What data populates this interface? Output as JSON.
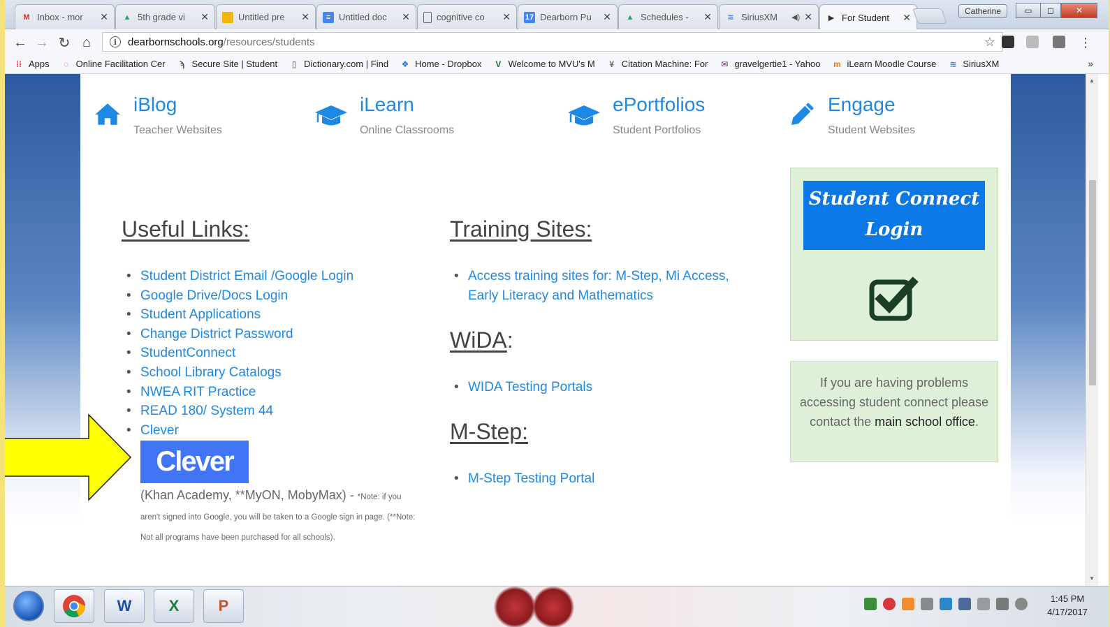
{
  "browser": {
    "tabs": [
      {
        "title": "Inbox - mor",
        "icon": "gmail-icon",
        "icon_glyph": "M",
        "icon_color": "#d93025"
      },
      {
        "title": "5th grade vi",
        "icon": "google-drive-icon",
        "icon_glyph": "▲",
        "icon_color": "#1fa463"
      },
      {
        "title": "Untitled pre",
        "icon": "google-slides-icon",
        "icon_glyph": "▭",
        "icon_color": "#f4b400"
      },
      {
        "title": "Untitled doc",
        "icon": "google-docs-icon",
        "icon_glyph": "≡",
        "icon_color": "#4285f4"
      },
      {
        "title": "cognitive co",
        "icon": "document-icon",
        "icon_glyph": "▯",
        "icon_color": "#666666"
      },
      {
        "title": "Dearborn Pu",
        "icon": "calendar-icon",
        "icon_glyph": "17",
        "icon_color": "#4285f4"
      },
      {
        "title": "Schedules -",
        "icon": "google-drive-icon",
        "icon_glyph": "▲",
        "icon_color": "#1fa463"
      },
      {
        "title": "SiriusXM",
        "icon": "siriusxm-icon",
        "icon_glyph": "≋",
        "icon_color": "#4a7fc1"
      },
      {
        "title": "For Student",
        "icon": "page-icon",
        "icon_glyph": "▶",
        "icon_color": "#333333"
      }
    ],
    "profile_name": "Catherine",
    "url_host": "dearbornschools.org",
    "url_path": "/resources/students",
    "bookmarks": [
      {
        "label": "Apps",
        "icon": "apps-grid-icon",
        "glyph": "⁞⁞",
        "color": "#e53935"
      },
      {
        "label": "Online Facilitation Cer",
        "icon": "circle-icon",
        "glyph": "◌",
        "color": "#e53935"
      },
      {
        "label": "Secure Site | Student",
        "icon": "secure-site-icon",
        "glyph": "ϡ",
        "color": "#555555"
      },
      {
        "label": "Dictionary.com | Find",
        "icon": "document-icon",
        "glyph": "▯",
        "color": "#555555"
      },
      {
        "label": "Home - Dropbox",
        "icon": "dropbox-icon",
        "glyph": "❖",
        "color": "#1e6fd9"
      },
      {
        "label": "Welcome to MVU's M",
        "icon": "mvu-icon",
        "glyph": "V",
        "color": "#1f6e3a"
      },
      {
        "label": "Citation Machine: For",
        "icon": "citation-machine-icon",
        "glyph": "¥",
        "color": "#6b6b6b"
      },
      {
        "label": "gravelgertie1 - Yahoo",
        "icon": "yahoo-mail-icon",
        "glyph": "✉",
        "color": "#5b2a86"
      },
      {
        "label": "iLearn Moodle Course",
        "icon": "moodle-icon",
        "glyph": "m",
        "color": "#e67e22"
      },
      {
        "label": "SiriusXM",
        "icon": "siriusxm-icon",
        "glyph": "≋",
        "color": "#4a7fc1"
      }
    ]
  },
  "features": [
    {
      "title": "iBlog",
      "subtitle": "Teacher Websites",
      "icon": "home-icon"
    },
    {
      "title": "iLearn",
      "subtitle": "Online Classrooms",
      "icon": "graduation-cap-icon"
    },
    {
      "title": "ePortfolios",
      "subtitle": "Student Portfolios",
      "icon": "graduation-cap-icon"
    },
    {
      "title": "Engage",
      "subtitle": "Student Websites",
      "icon": "pencil-icon"
    }
  ],
  "useful_links": {
    "heading": "Useful Links:",
    "items": [
      "Student District Email /Google Login",
      "Google Drive/Docs Login",
      "Student Applications",
      "Change District Password",
      "StudentConnect",
      "School Library Catalogs",
      "NWEA RIT Practice",
      "READ 180/ System 44",
      "Clever"
    ],
    "clever_logo": "Clever",
    "clever_note_main": "(Khan Academy, **MyON, MobyMax) - ",
    "clever_note_small": "*Note: if you aren't signed into Google, you will be taken to a Google sign in page. (**Note: Not all programs have been purchased for all schools)."
  },
  "training": {
    "heading": "Training Sites:",
    "items": [
      "Access training sites for: M-Step, Mi Access, Early Literacy and Mathematics"
    ]
  },
  "wida": {
    "heading": "WiDA",
    "suffix": ":",
    "items": [
      "WIDA Testing Portals"
    ]
  },
  "mstep": {
    "heading": "M-Step:",
    "items": [
      "M-Step Testing Portal"
    ]
  },
  "student_connect": {
    "button_line1": "Student Connect",
    "button_line2": "Login",
    "icon": "checkbox-checked-icon"
  },
  "help": {
    "text_before": "If you are having problems accessing student connect please contact the ",
    "text_bold": "main school office",
    "text_after": "."
  },
  "taskbar": {
    "apps": [
      "chrome-icon",
      "word-icon",
      "excel-icon",
      "powerpoint-icon"
    ],
    "time": "1:45 PM",
    "date": "4/17/2017"
  },
  "colors": {
    "link": "#1e88e5",
    "button_blue": "#0b78e6",
    "card_green": "#dff0d8",
    "arrow_yellow": "#ffff00",
    "clever_blue": "#4274f6"
  }
}
